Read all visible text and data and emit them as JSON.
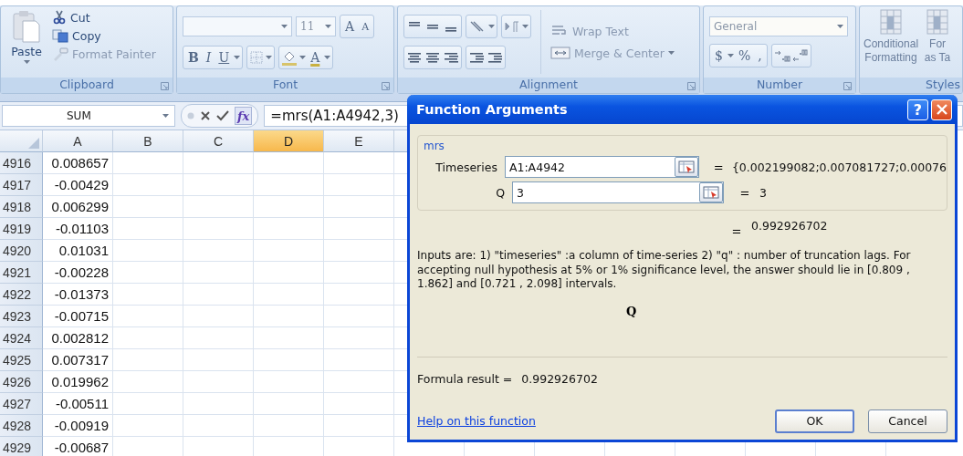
{
  "clipboard": {
    "paste": "Paste",
    "items": [
      "Cut",
      "Copy",
      "Format Painter"
    ],
    "label": "Clipboard"
  },
  "font": {
    "size": "11",
    "grow": "A",
    "shrink": "A",
    "format": [
      "B",
      "I",
      "U"
    ],
    "color_letter": "A",
    "label": "Font"
  },
  "alignment": {
    "wrap": "Wrap Text",
    "merge": "Merge & Center",
    "label": "Alignment"
  },
  "number": {
    "format": "General",
    "buttons": [
      "$",
      "%",
      ","
    ],
    "label": "Number"
  },
  "styles": {
    "buttons": [
      {
        "line1": "Conditional",
        "line2": "Formatting"
      },
      {
        "line1": "For",
        "line2": "as Ta"
      }
    ],
    "label": "Styles"
  },
  "formula_bar": {
    "name_box": "SUM",
    "function_label": "fx",
    "formula": "=mrs(A1:A4942,3)"
  },
  "sheet": {
    "columns": [
      {
        "label": "A",
        "selected": false
      },
      {
        "label": "B",
        "selected": false
      },
      {
        "label": "C",
        "selected": false
      },
      {
        "label": "D",
        "selected": true
      },
      {
        "label": "E",
        "selected": false
      }
    ],
    "rows": [
      {
        "number": "4916",
        "a": "0.008657"
      },
      {
        "number": "4917",
        "a": "-0.00429"
      },
      {
        "number": "4918",
        "a": "0.006299"
      },
      {
        "number": "4919",
        "a": "-0.01103"
      },
      {
        "number": "4920",
        "a": "0.01031"
      },
      {
        "number": "4921",
        "a": "-0.00228"
      },
      {
        "number": "4922",
        "a": "-0.01373"
      },
      {
        "number": "4923",
        "a": "-0.00715"
      },
      {
        "number": "4924",
        "a": "0.002812"
      },
      {
        "number": "4925",
        "a": "0.007317"
      },
      {
        "number": "4926",
        "a": "0.019962"
      },
      {
        "number": "4927",
        "a": "-0.00511"
      },
      {
        "number": "4928",
        "a": "-0.00919"
      },
      {
        "number": "4929",
        "a": "-0.00687"
      }
    ]
  },
  "dialog": {
    "title": "Function Arguments",
    "help_button": "?",
    "group": "mrs",
    "args": [
      {
        "label": "Timeseries",
        "value": "A1:A4942",
        "eq": "=",
        "result": "{0.002199082;0.007081727;0.00076"
      },
      {
        "label": "Q",
        "value": "3",
        "eq": "=",
        "result": "3"
      }
    ],
    "result_eq": "=",
    "function_result": "0.992926702",
    "description": "Inputs are: 1) \"timeseries\" :a column of time-series 2) \"q\" : number of truncation lags. For accepting null hypothesis at 5% or 1% significance level, the answer should lie in [0.809 , 1.862] and [0.721 , 2.098] intervals.",
    "arg_title": "Q",
    "formula_result_label": "Formula result =",
    "formula_result": "0.992926702",
    "help_link": "Help on this function",
    "buttons": [
      {
        "label": "OK",
        "default": true
      },
      {
        "label": "Cancel",
        "default": false
      }
    ]
  }
}
